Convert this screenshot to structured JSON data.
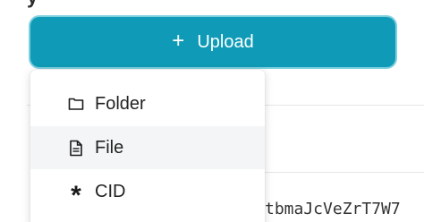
{
  "page": {
    "heading_fragment": "y"
  },
  "upload_button": {
    "icon": "plus-icon",
    "plus_glyph": "+",
    "label": "Upload"
  },
  "upload_menu": {
    "items": [
      {
        "label": "Folder",
        "icon": "folder-icon"
      },
      {
        "label": "File",
        "icon": "file-icon"
      },
      {
        "label": "CID",
        "icon": "asterisk-icon",
        "glyph": "*"
      }
    ],
    "hovered_item": "File"
  },
  "background": {
    "cid_fragment": "tbmaJcVeZrT7W7"
  },
  "colors": {
    "accent": "#0f9bb7",
    "accent_ring": "#7fd0df",
    "menu_hover": "#f4f5f6",
    "text": "#222222"
  }
}
